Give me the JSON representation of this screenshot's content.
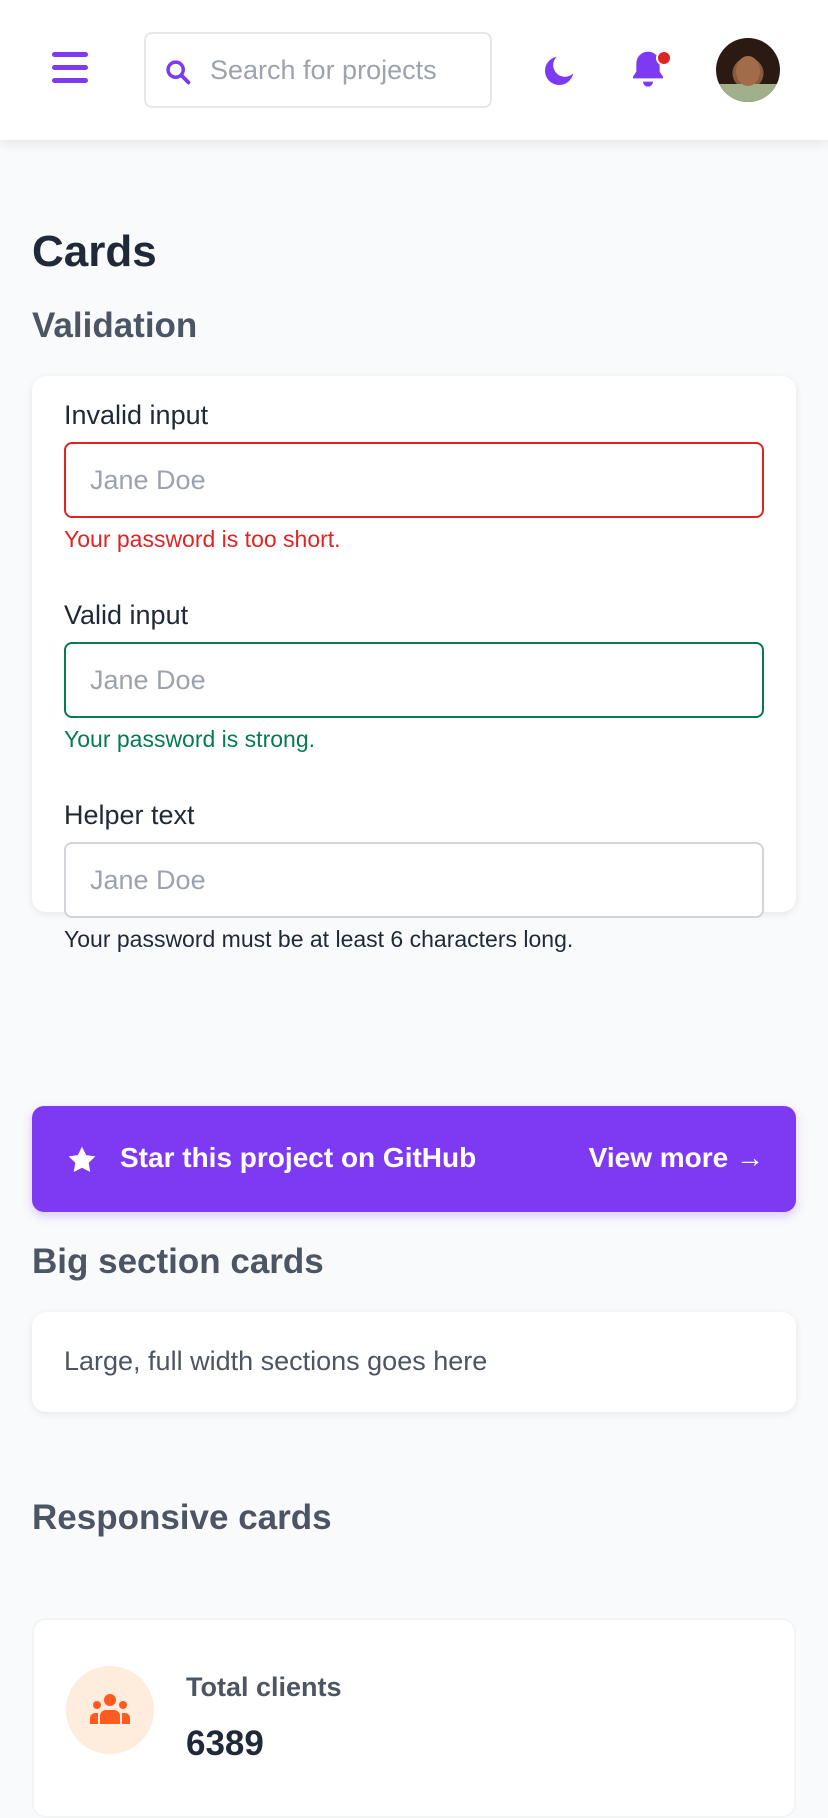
{
  "header": {
    "search_placeholder": "Search for projects"
  },
  "page": {
    "title": "Cards"
  },
  "validation": {
    "heading": "Validation",
    "invalid": {
      "label": "Invalid input",
      "placeholder": "Jane Doe",
      "message": "Your password is too short."
    },
    "valid": {
      "label": "Valid input",
      "placeholder": "Jane Doe",
      "message": "Your password is strong."
    },
    "helper": {
      "label": "Helper text",
      "placeholder": "Jane Doe",
      "message": "Your password must be at least 6 characters long."
    }
  },
  "banner": {
    "text": "Star this project on GitHub",
    "link": "View more →"
  },
  "big_section": {
    "heading": "Big section cards",
    "text": "Large, full width sections goes here"
  },
  "responsive": {
    "heading": "Responsive cards",
    "cards": [
      {
        "label": "Total clients",
        "value": "6389",
        "icon": "people-icon"
      }
    ]
  },
  "colors": {
    "accent": "#7e3af2",
    "error": "#e02424",
    "success": "#057a55",
    "notification_dot": "#e02424"
  },
  "icons": {
    "menu": "menu-icon",
    "search": "search-icon",
    "theme": "moon-icon",
    "notifications": "bell-icon",
    "banner": "star-icon"
  }
}
